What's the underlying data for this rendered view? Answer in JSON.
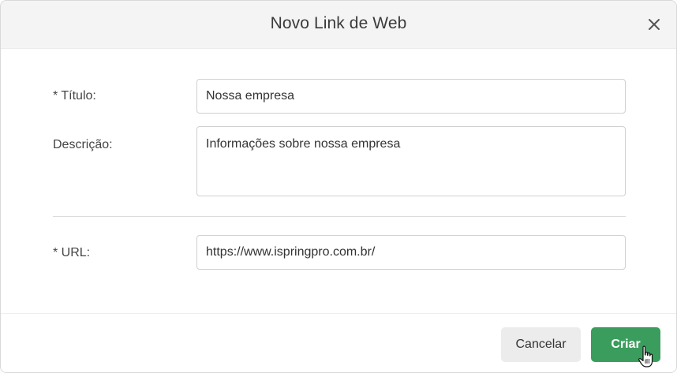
{
  "dialog": {
    "title": "Novo Link de Web",
    "close_icon": "close-icon"
  },
  "form": {
    "title_label": "* Título:",
    "title_value": "Nossa empresa",
    "description_label": "Descrição:",
    "description_value": "Informações sobre nossa empresa",
    "url_label": "* URL:",
    "url_value": "https://www.ispringpro.com.br/"
  },
  "footer": {
    "cancel_label": "Cancelar",
    "create_label": "Criar"
  },
  "colors": {
    "primary": "#3a9d5d",
    "header_bg": "#f4f4f4"
  }
}
